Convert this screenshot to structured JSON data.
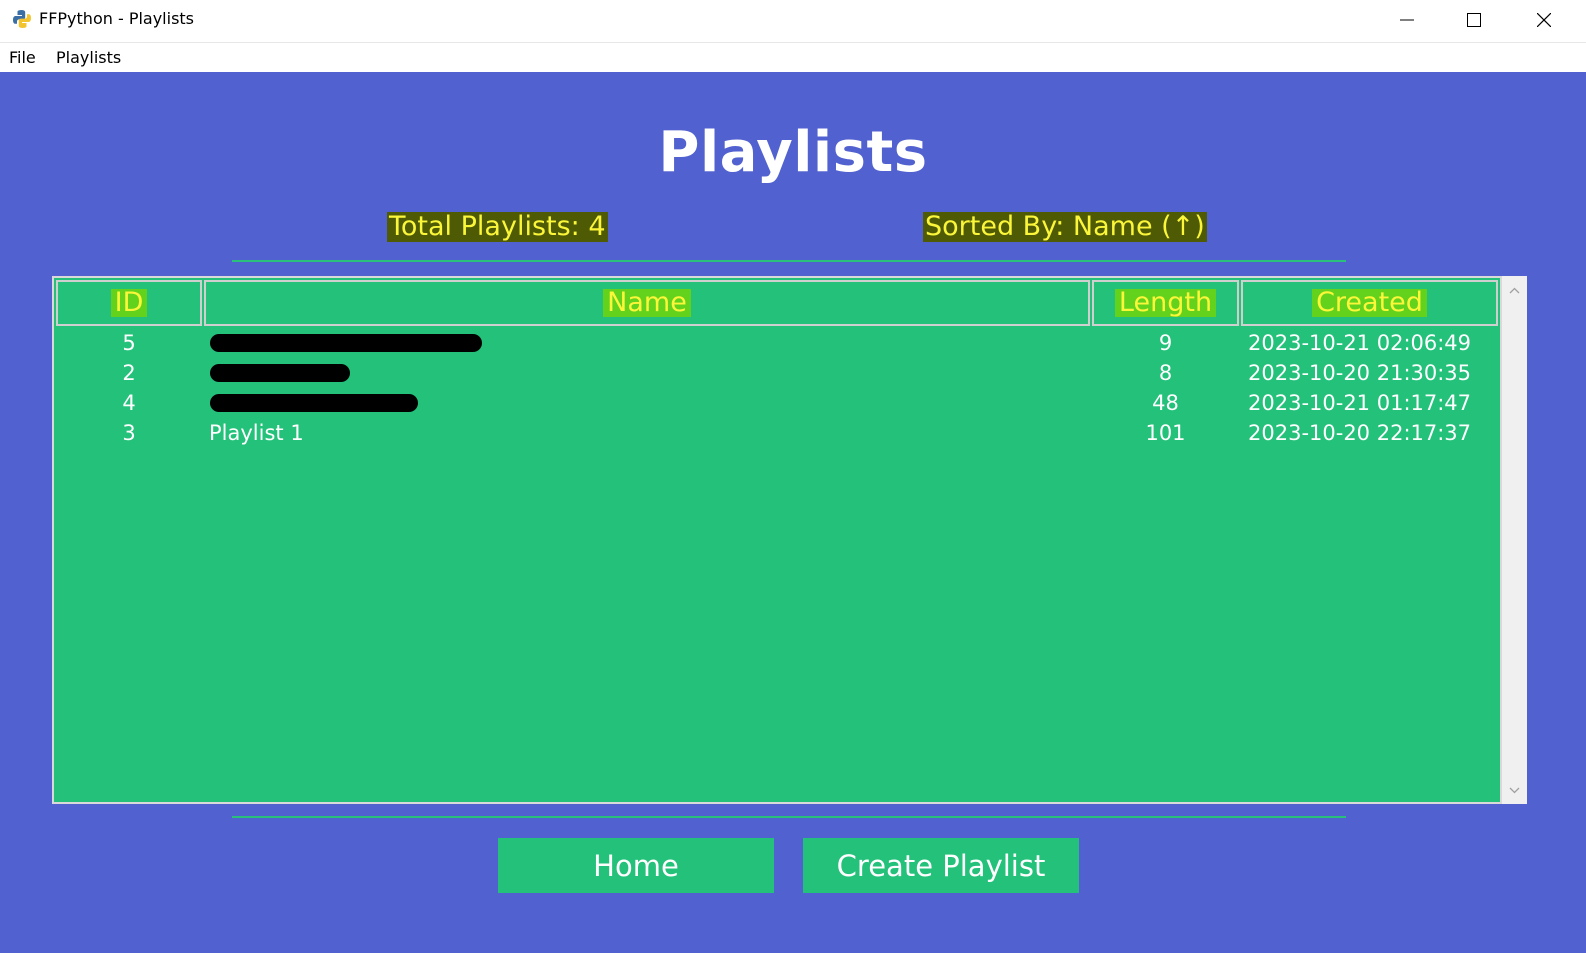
{
  "window": {
    "title": "FFPython - Playlists",
    "minimize_glyph": "─",
    "maximize_glyph": "☐",
    "close_glyph": "✕"
  },
  "menu": [
    "File",
    "Playlists"
  ],
  "page": {
    "title": "Playlists",
    "total_label": "Total Playlists: 4",
    "sorted_label": "Sorted By: Name (↑)"
  },
  "table": {
    "columns": [
      "ID",
      "Name",
      "Length",
      "Created"
    ],
    "rows": [
      {
        "id": "5",
        "name": "",
        "length": "9",
        "created": "2023-10-21 02:06:49"
      },
      {
        "id": "2",
        "name": "",
        "length": "8",
        "created": "2023-10-20 21:30:35"
      },
      {
        "id": "4",
        "name": "",
        "length": "48",
        "created": "2023-10-21 01:17:47"
      },
      {
        "id": "3",
        "name": "Playlist 1",
        "length": "101",
        "created": "2023-10-20 22:17:37"
      }
    ]
  },
  "buttons": {
    "home": "Home",
    "create": "Create Playlist"
  },
  "colors": {
    "background": "#5161cf",
    "table": "#24c17a",
    "accent_text": "#fbf63a"
  }
}
